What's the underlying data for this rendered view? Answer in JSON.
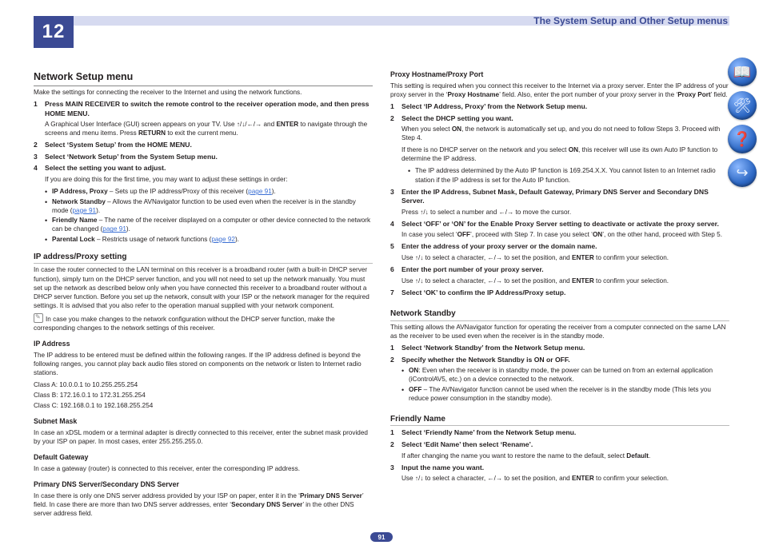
{
  "header": {
    "chapter_number": "12",
    "title": "The System Setup and Other Setup menus"
  },
  "page_badge": "91",
  "side_icons": [
    "book-icon",
    "tools-icon",
    "help-icon",
    "share-icon"
  ],
  "left": {
    "h_network_setup": "Network Setup menu",
    "intro": "Make the settings for connecting the receiver to the Internet and using the network functions.",
    "s1_n": "1",
    "s1_t": "Press MAIN RECEIVER to switch the remote control to the receiver operation mode, and then press HOME MENU.",
    "s1_body_a": "A Graphical User Interface (GUI) screen appears on your TV. Use ",
    "s1_body_b": " and ",
    "s1_body_c": "ENTER",
    "s1_body_d": " to navigate through the screens and menu items. Press ",
    "s1_body_e": "RETURN",
    "s1_body_f": " to exit the current menu.",
    "s2_n": "2",
    "s2_t": "Select ‘System Setup’ from the HOME MENU.",
    "s3_n": "3",
    "s3_t": "Select ‘Network Setup’ from the System Setup menu.",
    "s4_n": "4",
    "s4_t": "Select the setting you want to adjust.",
    "s4_body": "If you are doing this for the first time, you may want to adjust these settings in order:",
    "b_ip_a": "IP Address, Proxy",
    "b_ip_b": " – Sets up the IP address/Proxy of this receiver (",
    "b_ip_link": "page 91",
    "b_ip_c": ").",
    "b_ns_a": "Network Standby",
    "b_ns_b": " – Allows the AVNavigator function to be used even when the receiver is in the standby mode (",
    "b_ns_link": "page 91",
    "b_ns_c": ").",
    "b_fn_a": "Friendly Name",
    "b_fn_b": " – The name of the receiver displayed on a computer or other device connected to the network can be changed (",
    "b_fn_link": "page 91",
    "b_fn_c": ").",
    "b_pl_a": "Parental Lock",
    "b_pl_b": " – Restricts usage of network functions (",
    "b_pl_link": "page 92",
    "b_pl_c": ").",
    "h_ipproxy": "IP address/Proxy setting",
    "ipproxy_body": "In case the router connected to the LAN terminal on this receiver is a broadband router (with a built-in DHCP server function), simply turn on the DHCP server function, and you will not need to set up the network manually. You must set up the network as described below only when you have connected this receiver to a broadband router without a DHCP server function. Before you set up the network, consult with your ISP or the network manager for the required settings. It is advised that you also refer to the operation manual supplied with your network component.",
    "note_ip": "In case you make changes to the network configuration without the DHCP server function, make the corresponding changes to the network settings of this receiver.",
    "h_ipaddr": "IP Address",
    "ipaddr_body": "The IP address to be entered must be defined within the following ranges. If the IP address defined is beyond the following ranges, you cannot play back audio files stored on components on the network or listen to Internet radio stations.",
    "ipaddr_a": "Class A: 10.0.0.1 to 10.255.255.254",
    "ipaddr_b": "Class B: 172.16.0.1 to 172.31.255.254",
    "ipaddr_c": "Class C: 192.168.0.1 to 192.168.255.254",
    "h_subnet": "Subnet Mask",
    "subnet_body": "In case an xDSL modem or a terminal adapter is directly connected to this receiver, enter the subnet mask provided by your ISP on paper. In most cases, enter 255.255.255.0.",
    "h_gw": "Default Gateway",
    "gw_body": "In case a gateway (router) is connected to this receiver, enter the corresponding IP address.",
    "h_dns": "Primary DNS Server/Secondary DNS Server",
    "dns_body_a": "In case there is only one DNS server address provided by your ISP on paper, enter it in the ‘",
    "dns_body_b": "Primary DNS Server",
    "dns_body_c": "’ field. In case there are more than two DNS server addresses, enter ‘",
    "dns_body_d": "Secondary DNS Server",
    "dns_body_e": "’ in the other DNS server address field."
  },
  "right": {
    "h_proxyhost": "Proxy Hostname/Proxy Port",
    "proxyhost_a": "This setting is required when you connect this receiver to the Internet via a proxy server. Enter the IP address of your proxy server in the ‘",
    "proxyhost_b": "Proxy Hostname",
    "proxyhost_c": "’ field. Also, enter the port number of your proxy server in the ‘",
    "proxyhost_d": "Proxy Port",
    "proxyhost_e": "’ field.",
    "r1_n": "1",
    "r1_t": "Select ‘IP Address, Proxy’ from the Network Setup menu.",
    "r2_n": "2",
    "r2_t": "Select the DHCP setting you want.",
    "r2_body_a": "When you select ",
    "r2_body_b": "ON",
    "r2_body_c": ", the network is automatically set up, and you do not need to follow Steps 3. Proceed with Step 4.",
    "r2_body2_a": "If there is no DHCP server on the network and you select ",
    "r2_body2_b": "ON",
    "r2_body2_c": ", this receiver will use its own Auto IP function to determine the IP address.",
    "r2_bullet": "The IP address determined by the Auto IP function is 169.254.X.X. You cannot listen to an Internet radio station if the IP address is set for the Auto IP function.",
    "r3_n": "3",
    "r3_t": "Enter the IP Address, Subnet Mask, Default Gateway, Primary DNS Server and Secondary DNS Server.",
    "r3_body_a": "Press ",
    "r3_body_b": " to select a number and ",
    "r3_body_c": " to move the cursor.",
    "r4_n": "4",
    "r4_t": "Select ‘OFF’ or ‘ON’ for the Enable Proxy Server setting to deactivate or activate the proxy server.",
    "r4_body_a": "In case you select ‘",
    "r4_body_b": "OFF",
    "r4_body_c": "’, proceed with Step 7. In case you select ‘",
    "r4_body_d": "ON",
    "r4_body_e": "’, on the other hand, proceed with Step 5.",
    "r5_n": "5",
    "r5_t": "Enter the address of your proxy server or the domain name.",
    "r5_body_a": "Use ",
    "r5_body_b": " to select a character, ",
    "r5_body_c": " to set the position, and ",
    "r5_body_d": "ENTER",
    "r5_body_e": " to confirm your selection.",
    "r6_n": "6",
    "r6_t": "Enter the port number of your proxy server.",
    "r6_body_a": "Use ",
    "r6_body_b": " to select a character, ",
    "r6_body_c": " to set the position, and ",
    "r6_body_d": "ENTER",
    "r6_body_e": " to confirm your selection.",
    "r7_n": "7",
    "r7_t": "Select ‘OK’ to confirm the IP Address/Proxy setup.",
    "h_netstandby": "Network Standby",
    "ns_intro": "This setting allows the AVNavigator function for operating the receiver from a computer connected on the same LAN as the receiver to be used even when the receiver is in the standby mode.",
    "ns1_n": "1",
    "ns1_t": "Select ‘Network Standby’ from the Network Setup menu.",
    "ns2_n": "2",
    "ns2_t": "Specify whether the Network Standby is ON or OFF.",
    "ns_on_a": "ON",
    "ns_on_b": ": Even when the receiver is in standby mode, the power can be turned on from an external application (iControlAV5, etc.) on a device connected to the network.",
    "ns_off_a": "OFF",
    "ns_off_b": " – The AVNavigator function cannot be used when the receiver is in the standby mode (This lets you reduce power consumption in the standby mode).",
    "h_friendly": "Friendly Name",
    "fn1_n": "1",
    "fn1_t": "Select ‘Friendly Name’ from the Network Setup menu.",
    "fn2_n": "2",
    "fn2_t": "Select ‘Edit Name’ then select ‘Rename’.",
    "fn2_body_a": "If after changing the name you want to restore the name to the default, select ",
    "fn2_body_b": "Default",
    "fn2_body_c": ".",
    "fn3_n": "3",
    "fn3_t": "Input the name you want.",
    "fn3_body_a": "Use ",
    "fn3_body_b": " to select a character, ",
    "fn3_body_c": " to set the position, and ",
    "fn3_body_d": "ENTER",
    "fn3_body_e": " to confirm your selection."
  }
}
